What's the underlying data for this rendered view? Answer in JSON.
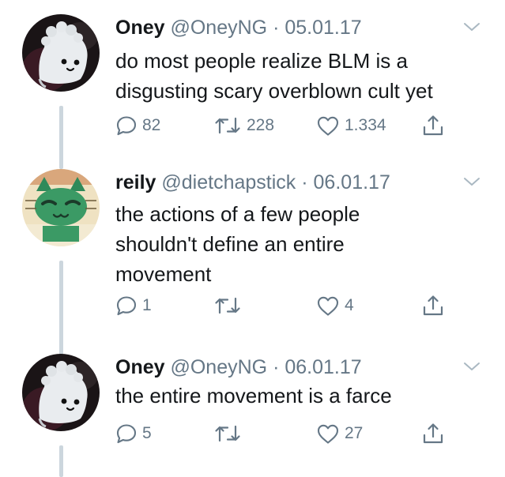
{
  "tweets": [
    {
      "name": "Oney",
      "handle": "@OneyNG",
      "separator": "·",
      "date": "05.01.17",
      "text_lines": [
        "do most people realize BLM is a",
        "disgusting scary overblown cult yet"
      ],
      "replies": "82",
      "retweets": "228",
      "likes": "1.334"
    },
    {
      "name": "reily",
      "handle": "@dietchapstick",
      "separator": "·",
      "date": "06.01.17",
      "text_lines": [
        "the actions of a few people",
        "shouldn't define an entire",
        "movement"
      ],
      "replies": "1",
      "retweets": "",
      "likes": "4"
    },
    {
      "name": "Oney",
      "handle": "@OneyNG",
      "separator": "·",
      "date": "06.01.17",
      "text_lines": [
        "the entire movement is a farce"
      ],
      "replies": "5",
      "retweets": "",
      "likes": "27"
    }
  ],
  "icons": {
    "reply": "reply-icon",
    "retweet": "retweet-icon",
    "like": "heart-icon",
    "share": "share-icon",
    "menu": "chevron-down-icon"
  },
  "colors": {
    "text": "#14171a",
    "muted": "#657786",
    "thread_line": "#ccd6dd",
    "chevron": "#aab8c2"
  }
}
